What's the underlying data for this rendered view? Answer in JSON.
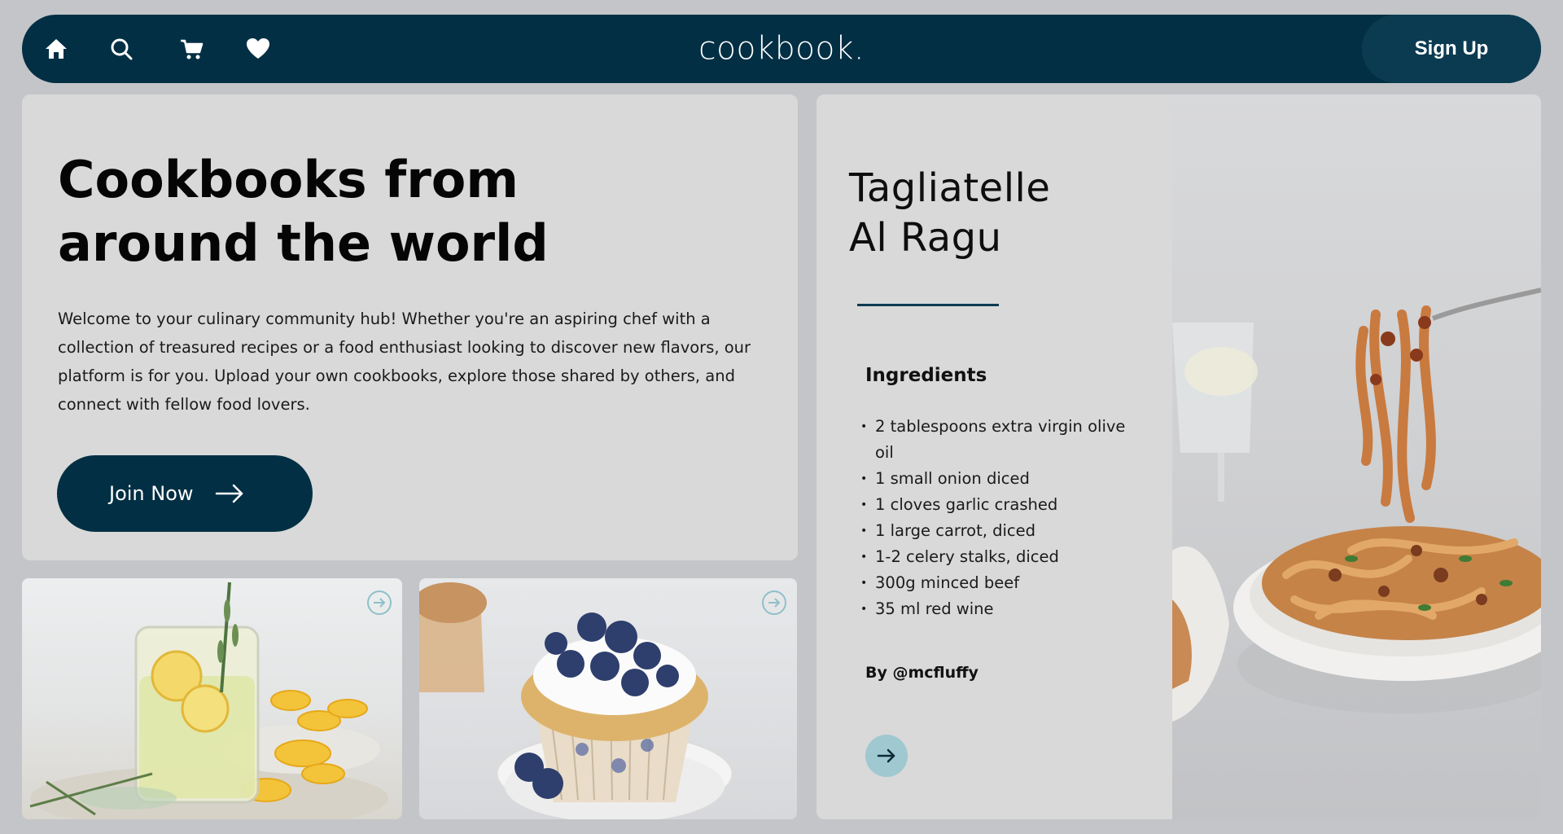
{
  "nav": {
    "icons": [
      "home-icon",
      "search-icon",
      "cart-icon",
      "heart-icon"
    ],
    "brand": "cookbook.",
    "signup_label": "Sign Up"
  },
  "hero": {
    "title_line1": "Cookbooks from",
    "title_line2": "around the world",
    "body": "Welcome to your culinary community hub! Whether you're an aspiring chef with a collection of treasured recipes or a food enthusiast looking to discover new flavors, our platform is for you. Upload your own cookbooks, explore those shared by others, and connect with fellow food lovers.",
    "cta_label": "Join Now"
  },
  "recipe": {
    "title_line1": "Tagliatelle",
    "title_line2": "Al Ragu",
    "ingredients_heading": "Ingredients",
    "ingredients": [
      "2 tablespoons extra virgin olive oil",
      "1 small onion diced",
      "1 cloves garlic crashed",
      "1 large carrot, diced",
      "1-2 celery stalks, diced",
      "300g minced beef",
      "35 ml red wine"
    ],
    "author": "By @mcfluffy"
  },
  "colors": {
    "navy": "#032f44",
    "panel": "#d9d9d9",
    "accent_teal": "#9fc8d0"
  }
}
